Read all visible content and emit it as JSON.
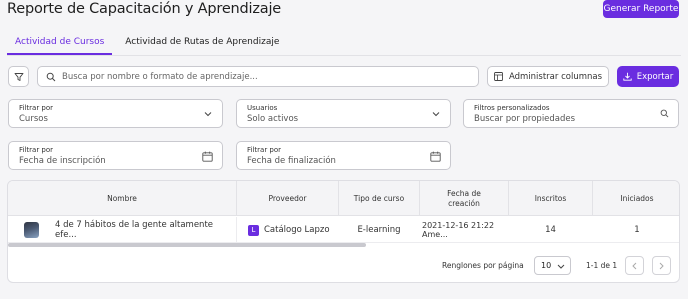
{
  "header": {
    "title": "Reporte de Capacitación y Aprendizaje",
    "generate_button": "Generar Reporte"
  },
  "tabs": [
    {
      "label": "Actividad de Cursos",
      "active": true
    },
    {
      "label": "Actividad de Rutas de Aprendizaje",
      "active": false
    }
  ],
  "toolbar": {
    "search_placeholder": "Busca por nombre o formato de aprendizaje...",
    "admin_columns_label": "Administrar columnas",
    "export_label": "Exportar"
  },
  "filters": {
    "filter_by": {
      "label": "Filtrar por",
      "value": "Cursos"
    },
    "users": {
      "label": "Usuarios",
      "value": "Solo activos"
    },
    "custom": {
      "label": "Filtros personalizados",
      "placeholder": "Buscar por propiedades"
    },
    "enroll_date": {
      "label": "Filtrar por",
      "value": "Fecha de inscripción"
    },
    "end_date": {
      "label": "Filtrar por",
      "value": "Fecha de finalización"
    }
  },
  "table": {
    "columns": [
      "Nombre",
      "Proveedor",
      "Tipo de curso",
      "Fecha de creación",
      "Inscritos",
      "Iniciados"
    ],
    "rows": [
      {
        "name": "4 de 7 hábitos de la gente altamente efe...",
        "provider": "Catálogo Lapzo",
        "type": "E-learning",
        "created": "2021-12-16 21:22 Ame...",
        "enrolled": "14",
        "started": "1"
      }
    ]
  },
  "pagination": {
    "rows_per_page_label": "Renglones por página",
    "rows_per_page": "10",
    "range": "1-1 de 1"
  },
  "colors": {
    "accent": "#6a2de0"
  },
  "icons": [
    "filter-icon",
    "search-icon",
    "columns-icon",
    "download-icon",
    "chevron-down-icon",
    "calendar-icon",
    "chevron-left-icon",
    "chevron-right-icon"
  ]
}
